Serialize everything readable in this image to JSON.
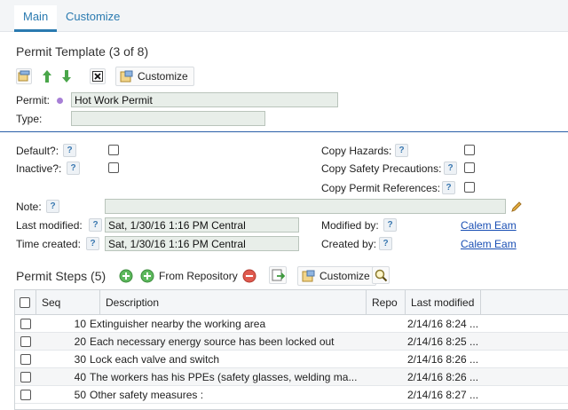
{
  "tabs": [
    {
      "label": "Main"
    },
    {
      "label": "Customize"
    }
  ],
  "template": {
    "title": "Permit Template (3 of 8)",
    "toolbar_customize": "Customize"
  },
  "form": {
    "permit_label": "Permit:",
    "permit_value": "Hot Work Permit",
    "type_label": "Type:",
    "type_value": "",
    "default_label": "Default?:",
    "inactive_label": "Inactive?:",
    "copy_hazards_label": "Copy Hazards:",
    "copy_safety_label": "Copy Safety Precautions:",
    "copy_permit_refs_label": "Copy Permit References:",
    "note_label": "Note:",
    "note_value": "",
    "last_modified_label": "Last modified:",
    "last_modified_value": "Sat, 1/30/16 1:16 PM Central",
    "time_created_label": "Time created:",
    "time_created_value": "Sat, 1/30/16 1:16 PM Central",
    "modified_by_label": "Modified by:",
    "modified_by_value": "Calem Eam",
    "created_by_label": "Created by:",
    "created_by_value": "Calem Eam",
    "help": "?"
  },
  "steps": {
    "title": "Permit Steps (5)",
    "from_repository": "From Repository",
    "customize": "Customize",
    "columns": {
      "seq": "Seq",
      "description": "Description",
      "repo": "Repo",
      "last_modified": "Last modified"
    },
    "rows": [
      {
        "seq": "10",
        "description": "Extinguisher nearby the working area",
        "repo": "",
        "last_modified": "2/14/16 8:24 ..."
      },
      {
        "seq": "20",
        "description": "Each necessary energy source has been locked out",
        "repo": "",
        "last_modified": "2/14/16 8:25 ..."
      },
      {
        "seq": "30",
        "description": "Lock each valve and switch",
        "repo": "",
        "last_modified": "2/14/16 8:26 ..."
      },
      {
        "seq": "40",
        "description": "The workers has his PPEs (safety glasses, welding ma...",
        "repo": "",
        "last_modified": "2/14/16 8:26 ..."
      },
      {
        "seq": "50",
        "description": "Other safety measures :",
        "repo": "",
        "last_modified": "2/14/16 8:27 ..."
      }
    ]
  }
}
